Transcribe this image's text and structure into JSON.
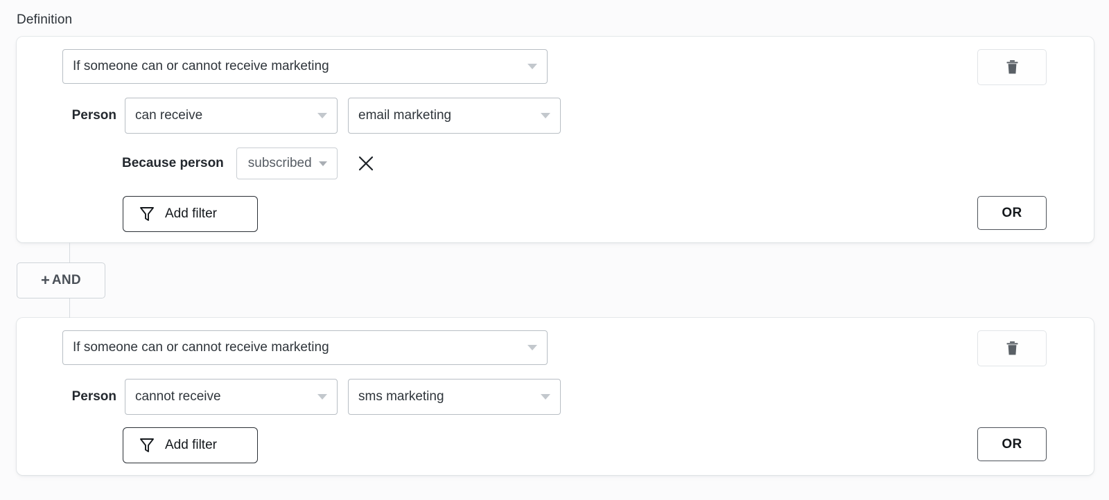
{
  "section": {
    "label": "Definition"
  },
  "connector": {
    "and_plus": "+",
    "and_label": "AND"
  },
  "groups": [
    {
      "condition_label": "If someone can or cannot receive marketing",
      "person_label": "Person",
      "operator": "can receive",
      "channel": "email marketing",
      "reason_label": "Because person",
      "reason_value": "subscribed",
      "remove_icon": "close-icon",
      "add_filter_label": "Add filter",
      "filter_icon": "funnel-icon",
      "delete_icon": "trash-icon",
      "or_label": "OR"
    },
    {
      "condition_label": "If someone can or cannot receive marketing",
      "person_label": "Person",
      "operator": "cannot receive",
      "channel": "sms marketing",
      "add_filter_label": "Add filter",
      "filter_icon": "funnel-icon",
      "delete_icon": "trash-icon",
      "or_label": "OR"
    }
  ],
  "colors": {
    "page_background": "#fbfbfc",
    "card_background": "#ffffff",
    "text_primary": "#23282e",
    "border_strong": "#2a2f35",
    "border_soft": "#b8bec4",
    "caret": "#c3c8cd"
  }
}
